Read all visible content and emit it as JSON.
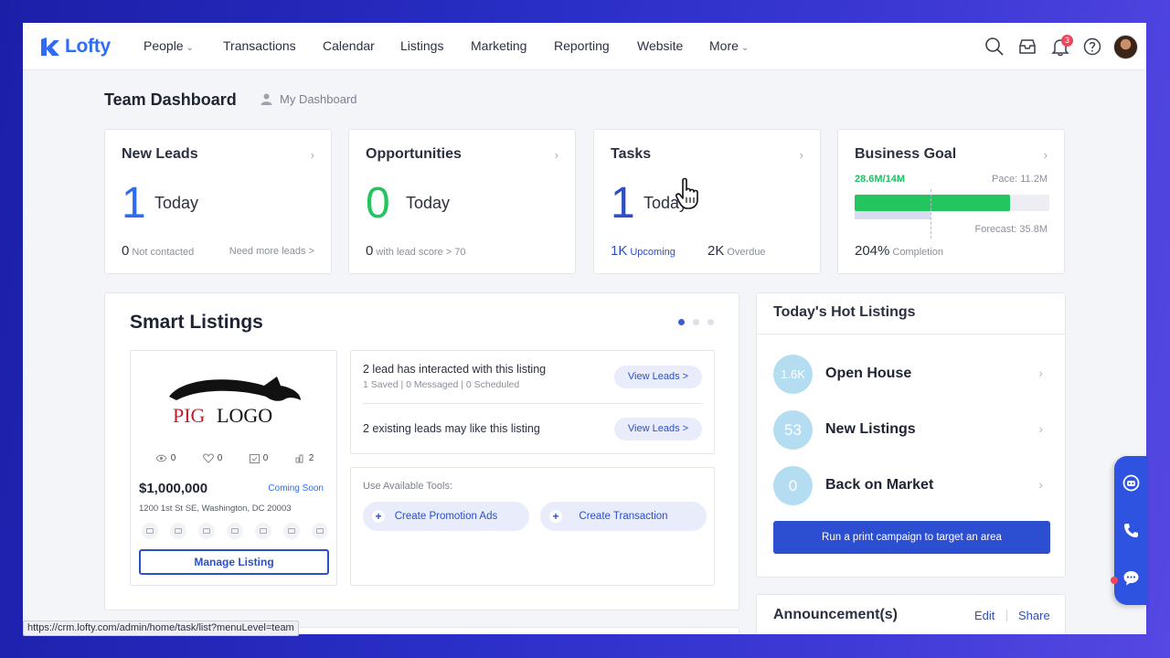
{
  "nav": {
    "logo": "Lofty",
    "items": [
      "People",
      "Transactions",
      "Calendar",
      "Listings",
      "Marketing",
      "Reporting",
      "Website",
      "More"
    ],
    "notification_count": "3",
    "icons": [
      "search-icon",
      "inbox-icon",
      "bell-icon",
      "help-icon"
    ]
  },
  "header": {
    "title": "Team Dashboard",
    "my_dashboard": "My Dashboard"
  },
  "kpis": {
    "new_leads": {
      "title": "New Leads",
      "value": "1",
      "period": "Today",
      "foot_value": "0",
      "foot_label": "Not contacted",
      "foot_link": "Need more leads >"
    },
    "opportunities": {
      "title": "Opportunities",
      "value": "0",
      "period": "Today",
      "foot_value": "0",
      "foot_label": "with lead score > 70"
    },
    "tasks": {
      "title": "Tasks",
      "value": "1",
      "period": "Today",
      "upcoming_value": "1K",
      "upcoming_label": "Upcoming",
      "overdue_value": "2K",
      "overdue_label": "Overdue"
    },
    "business_goal": {
      "title": "Business Goal",
      "progress_label": "28.6M/14M",
      "pace": "Pace: 11.2M",
      "forecast": "Forecast: 35.8M",
      "completion_value": "204%",
      "completion_label": "Completion",
      "progress_fraction": 0.8,
      "pace_fraction": 0.39
    }
  },
  "smart_listings": {
    "title": "Smart Listings",
    "logo_text": "PIG LOGO",
    "stats": [
      "0",
      "0",
      "0",
      "2"
    ],
    "price": "$1,000,000",
    "status": "Coming Soon",
    "address": "1200 1st St SE, Washington, DC 20003",
    "manage_label": "Manage Listing",
    "lead_rows": [
      {
        "title": "2 lead has interacted with this listing",
        "sub": "1 Saved | 0 Messaged | 0 Scheduled",
        "button": "View Leads >"
      },
      {
        "title": "2 existing leads may like this listing",
        "sub": "",
        "button": "View Leads >"
      }
    ],
    "tools_label": "Use Available Tools:",
    "tools": [
      "Create Promotion Ads",
      "Create Transaction"
    ]
  },
  "hot_listings": {
    "title": "Today's Hot Listings",
    "rows": [
      {
        "count": "1.6K",
        "label": "Open House"
      },
      {
        "count": "53",
        "label": "New Listings"
      },
      {
        "count": "0",
        "label": "Back on Market"
      }
    ],
    "campaign": "Run a print campaign to target an area"
  },
  "announcements": {
    "title": "Announcement(s)",
    "edit": "Edit",
    "share": "Share"
  },
  "status_url": "https://crm.lofty.com/admin/home/task/list?menuLevel=team",
  "colors": {
    "brand": "#2f6cf6",
    "accent": "#2c4fd1",
    "green": "#22c55e",
    "hot_circle": "#b4ddf2"
  }
}
